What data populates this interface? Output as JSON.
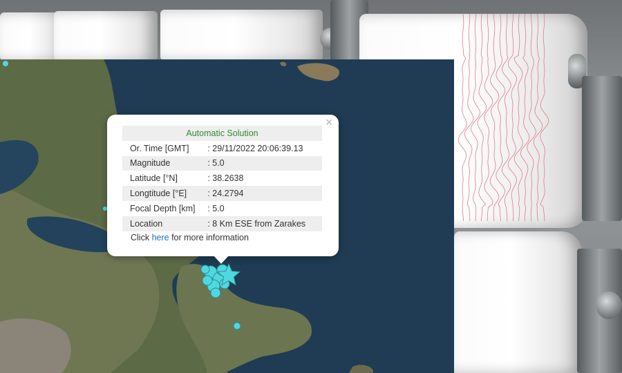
{
  "popup": {
    "title": "Automatic Solution",
    "close_symbol": "×",
    "rows": [
      {
        "label": "Or. Time [GMT]",
        "value": ": 29/11/2022 20:06:39.13"
      },
      {
        "label": "Magnitude",
        "value": ": 5.0"
      },
      {
        "label": "Latitude [°N]",
        "value": ": 38.2638"
      },
      {
        "label": "Longtitude [°E]",
        "value": ": 24.2794"
      },
      {
        "label": "Focal Depth [km]",
        "value": ": 5.0"
      },
      {
        "label": "Location",
        "value": ": 8 Km ESE from Zarakes"
      }
    ],
    "more_info": {
      "prefix": "Click ",
      "link_text": "here",
      "suffix": " for more information"
    }
  },
  "map": {
    "sea_color": "#1f3c54",
    "land_color": "#5f6b4a",
    "event_marker_color": "#4fd8e0",
    "epicenter_icon": "star-icon"
  },
  "photo": {
    "trace_color": "#e07b8a"
  }
}
